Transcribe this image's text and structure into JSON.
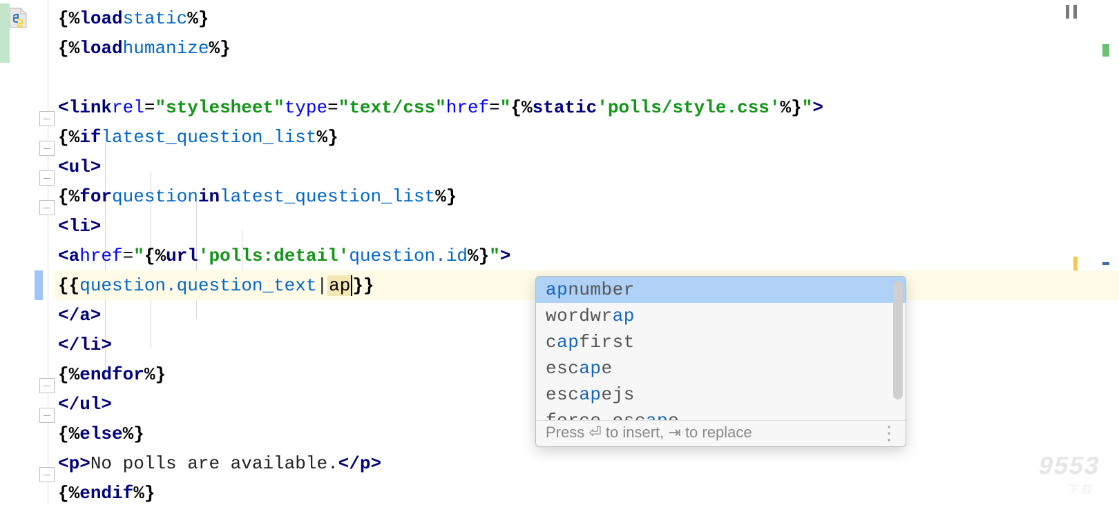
{
  "file_icon": "python-file-icon",
  "code": {
    "line1": {
      "delim_open": "{%",
      "kw": "load",
      "name": "static",
      "delim_close": "%}"
    },
    "line2": {
      "delim_open": "{%",
      "kw": "load",
      "name": "humanize",
      "delim_close": "%}"
    },
    "line4": {
      "open": "<",
      "tag": "link",
      "rel_attr": "rel",
      "rel_val": "\"stylesheet\"",
      "type_attr": "type",
      "type_val": "\"text/css\"",
      "href_attr": "href",
      "href_open": "\"",
      "href_delim_open": "{%",
      "href_kw": "static",
      "href_str": "'polls/style.css'",
      "href_delim_close": "%}",
      "href_close": "\"",
      "close": ">"
    },
    "line5": {
      "delim_open": "{%",
      "kw": "if",
      "name": "latest_question_list",
      "delim_close": "%}"
    },
    "line6": {
      "text": "<ul>"
    },
    "line7": {
      "delim_open": "{%",
      "kw": "for",
      "var": "question",
      "in": "in",
      "list": "latest_question_list",
      "delim_close": "%}"
    },
    "line8": {
      "text": "<li>"
    },
    "line9": {
      "open": "<",
      "tag": "a",
      "href_attr": "href",
      "href_open": "\"",
      "delim_open": "{%",
      "url_kw": "url",
      "url_str": "'polls:detail'",
      "url_arg": "question.id",
      "delim_close": "%}",
      "href_close": "\"",
      "close": ">"
    },
    "line10": {
      "delim_open": "{{",
      "expr": "question.question_text",
      "pipe": "|",
      "typed": "ap",
      "delim_close": "}}"
    },
    "line11": {
      "text": "</a>"
    },
    "line12": {
      "text": "</li>"
    },
    "line13": {
      "delim_open": "{%",
      "kw": "endfor",
      "delim_close": "%}"
    },
    "line14": {
      "text": "</ul>"
    },
    "line15": {
      "delim_open": "{%",
      "kw": "else",
      "delim_close": "%}"
    },
    "line16": {
      "open": "<p>",
      "text": "No polls are available.",
      "close": "</p>"
    },
    "line17": {
      "delim_open": "{%",
      "kw": "endif",
      "delim_close": "%}"
    }
  },
  "popup": {
    "items": [
      {
        "full": "apnumber",
        "match": "ap",
        "rest": "number"
      },
      {
        "full": "wordwrap",
        "pre": "wordwr",
        "match": "ap",
        "rest": ""
      },
      {
        "full": "capfirst",
        "pre": "c",
        "match": "ap",
        "rest": "first"
      },
      {
        "full": "escape",
        "pre": "esc",
        "match": "ap",
        "rest": "e"
      },
      {
        "full": "escapejs",
        "pre": "esc",
        "match": "ap",
        "rest": "ejs"
      },
      {
        "full": "force_escape",
        "pre": "force_esc",
        "match": "ap",
        "rest": "e"
      }
    ],
    "hint_pre": "Press ",
    "hint_insert_glyph": "⏎",
    "hint_mid": " to insert, ",
    "hint_replace_glyph": "⇥",
    "hint_post": " to replace"
  },
  "watermark": {
    "brand": "9553",
    "sub": "下载"
  },
  "colors": {
    "keyword": "#000080",
    "name": "#0066cc",
    "string": "#139618",
    "highlight_bg": "#fffbe6"
  }
}
